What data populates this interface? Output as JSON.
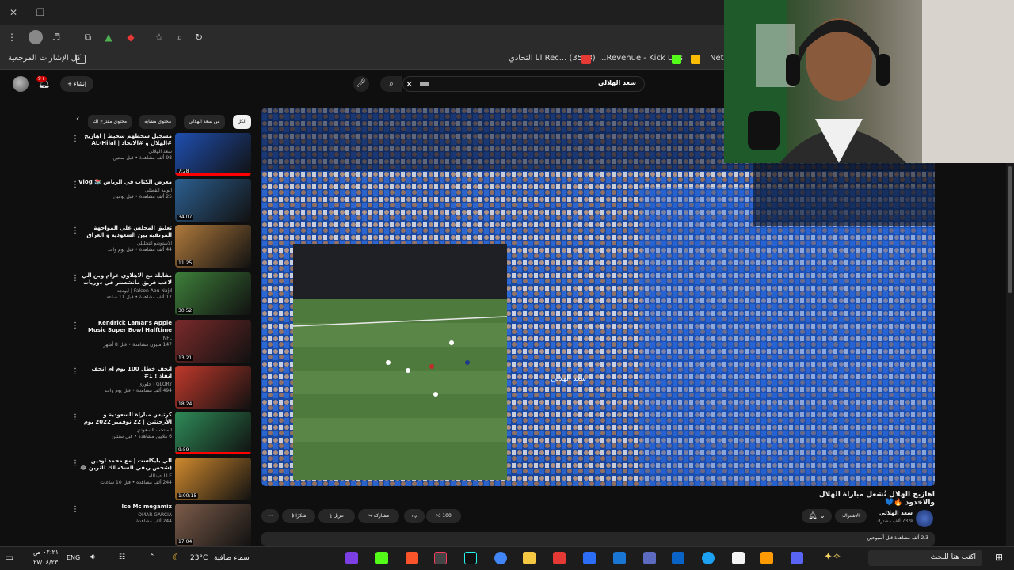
{
  "browser": {
    "bookmarks": {
      "all_bookmarks": "كل الإشارات المرجعية",
      "items": [
        "Rec... (3573) انا التحادي",
        "Revenue - Kick Das...",
        "Neti"
      ]
    }
  },
  "youtube": {
    "search_query": "سعد الهلالي",
    "create_label": "إنشاء",
    "notif_count": "9+",
    "chips": [
      "الكل",
      "من سعد الهلالي",
      "محتوى مشابه",
      "محتوى مقترح لك"
    ],
    "recommendations": [
      {
        "title": "مشجيل شخطهم شخيط | اهازيج #الهلال و #الاتحاد | AL-Hilal",
        "channel": "سعد الهلالي",
        "stats": "98 ألف مشاهدة • قبل سنتين",
        "duration": "7:28",
        "watched": 1.0
      },
      {
        "title": "معرض الكتاب في الرياض 📚 Vlog",
        "channel": "الوليد الفضلي",
        "stats": "25 ألف مشاهدة • قبل يومين",
        "duration": "34:07",
        "watched": 0
      },
      {
        "title": "تعليق المجلس علي المواجهة المرتقبة بين السعودية و العراق مباراة التاريخ",
        "channel": "الاستوديو التحليلي",
        "stats": "44 ألف مشاهدة • قبل يوم واحد",
        "duration": "11:25",
        "watched": 0
      },
      {
        "title": "مقابلة مع الاهلاوي عزام وبن الي لاعب فريق مانشستر في دوريات ايت | ...Interview with",
        "channel": "Falcon Abu Najd | ابونجد",
        "stats": "17 ألف مشاهدة • قبل 11 ساعة",
        "duration": "30:52",
        "watched": 0
      },
      {
        "title": "Kendrick Lamar's Apple Music Super Bowl Halftime Show",
        "channel": "NFL",
        "stats": "147 مليون مشاهدة • قبل 8 أشهر",
        "duration": "13:21",
        "watched": 0
      },
      {
        "title": "انجف خطل 100 يوم ام انحف انقاذ ! 1#",
        "channel": "GLORY | حلوري",
        "stats": "494 ألف مشاهدة • قبل يوم واحد",
        "duration": "18:24",
        "watched": 0
      },
      {
        "title": "كرتيس مباراة السعودية و الأرجنتين | 22 نوفمبر 2022 يوم لا ينسى",
        "channel": "المنتخب السعودي",
        "stats": "6 ملايين مشاهدة • قبل سنتين",
        "duration": "9:59",
        "watched": 1.0
      },
      {
        "title": "الي بايكاست | مع محمد اودين (شخص ريفي السكمالك للترين 😂 !!)",
        "channel": "LLE عبدالله",
        "stats": "244 ألف مشاهدة • قبل 10 ساعات",
        "duration": "1:00:15",
        "watched": 0
      },
      {
        "title": "Ice Mc megamix",
        "channel": "OMAR GARCIA",
        "stats": "244 ألف مشاهدة",
        "duration": "17:04",
        "watched": 0
      }
    ],
    "video": {
      "title": "اهازيج الهلال تُشعل مباراة الهلال والاخدود 🔥💙",
      "channel": "سعد الهلالي",
      "subscribers": "73.9 ألف مشترك",
      "subscribed_label": "الاشتراك",
      "likes": "100",
      "share": "مشاركة",
      "download": "تنزيل",
      "thanks": "شكرًا",
      "description": "2.3 ألف مشاهدة قبل أسبوعين",
      "overlay_text": "سعد الهلالي"
    }
  },
  "taskbar": {
    "search_placeholder": "اكتب هنا للبحث",
    "weather": "سماء صافية",
    "temperature": "23°C",
    "language": "ENG",
    "time": "٠٢:٢١ ص",
    "date": "٢٧/٠٤/٢٣"
  }
}
